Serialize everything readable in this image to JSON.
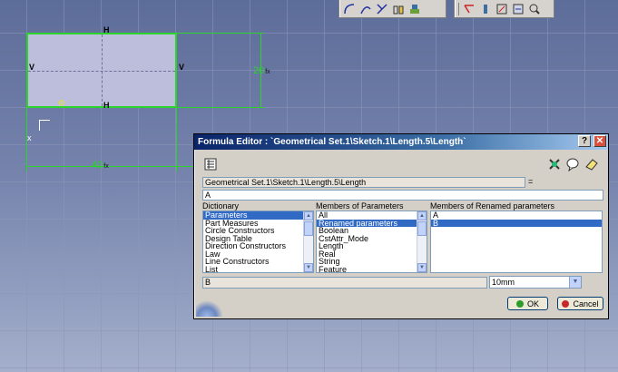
{
  "dialog": {
    "title": "Formula Editor : `Geometrical Set.1\\Sketch.1\\Length.5\\Length`",
    "help_label": "?",
    "close_label": "✕",
    "path_field": "Geometrical Set.1\\Sketch.1\\Length.5\\Length",
    "equals_sign": "=",
    "formula_value": "A",
    "dictionary": {
      "header": "Dictionary",
      "items": [
        "Parameters",
        "Part Measures",
        "Circle Constructors",
        "Design Table",
        "Direction Constructors",
        "Law",
        "Line Constructors",
        "List"
      ],
      "selected_index": 0
    },
    "members": {
      "header": "Members of Parameters",
      "items": [
        "All",
        "Renamed parameters",
        "Boolean",
        "CstAttr_Mode",
        "Length",
        "Real",
        "String",
        "Feature"
      ],
      "selected_index": 1
    },
    "renamed": {
      "header": "Members of Renamed parameters",
      "items": [
        "A",
        "B"
      ],
      "selected_index": 1
    },
    "selected_param": "B",
    "value_select": "10mm",
    "ok_label": "OK",
    "cancel_label": "Cancel"
  },
  "sketch": {
    "dim_vertical": "20",
    "dim_horizontal": "40",
    "symbol_top": "H",
    "symbol_bottom": "H",
    "symbol_left": "V",
    "symbol_right": "V",
    "axis_label": "x"
  },
  "colors": {
    "sketch_green": "#2bd32b",
    "selection_blue": "#316ac5",
    "ok_dot": "#2a9d2a",
    "cancel_dot": "#c62828"
  }
}
